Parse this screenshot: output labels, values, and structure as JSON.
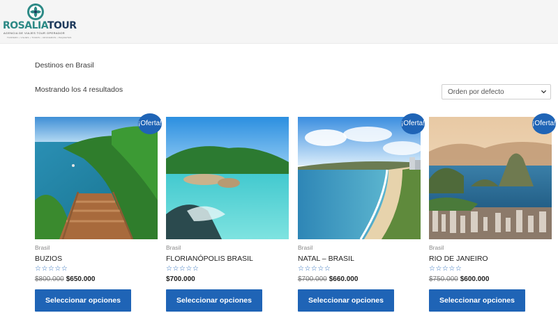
{
  "brand": {
    "name_part1": "ROSALIA",
    "name_part2": "TOUR",
    "tagline": "AGENCIA DE VIAJES TOUR OPERADOR",
    "subline": "TURISMO • VIAJES • TOURS • CRUCEROS • PAQUETES",
    "colors": {
      "teal": "#2d8a86",
      "navy": "#1e3a5c"
    },
    "icon": "flower-logo-icon"
  },
  "breadcrumb": "Destinos en Brasil",
  "result_count": "Mostrando los 4 resultados",
  "orderby": {
    "selected": "Orden por defecto",
    "icon": "chevron-down-icon"
  },
  "accent_color": "#1f64b6",
  "products": [
    {
      "category": "Brasil",
      "title": "BUZIOS",
      "rating_stars": "☆☆☆☆☆",
      "old_price": "$800.000",
      "price": "$650.000",
      "badge": "¡Oferta!",
      "button": "Seleccionar opciones",
      "image": "buzios-coast-stairs-photo"
    },
    {
      "category": "Brasil",
      "title": "FLORIANÓPOLIS BRASIL",
      "rating_stars": "☆☆☆☆☆",
      "old_price": "",
      "price": "$700.000",
      "badge": "",
      "button": "Seleccionar opciones",
      "image": "florianopolis-turquoise-beach-photo"
    },
    {
      "category": "Brasil",
      "title": "NATAL – BRASIL",
      "rating_stars": "☆☆☆☆☆",
      "old_price": "$700.000",
      "price": "$660.000",
      "badge": "¡Oferta!",
      "button": "Seleccionar opciones",
      "image": "natal-beach-aerial-photo"
    },
    {
      "category": "Brasil",
      "title": "RIO DE JANEIRO",
      "rating_stars": "☆☆☆☆☆",
      "old_price": "$750.000",
      "price": "$600.000",
      "badge": "¡Oferta!",
      "button": "Seleccionar opciones",
      "image": "rio-sugarloaf-bay-photo"
    }
  ]
}
